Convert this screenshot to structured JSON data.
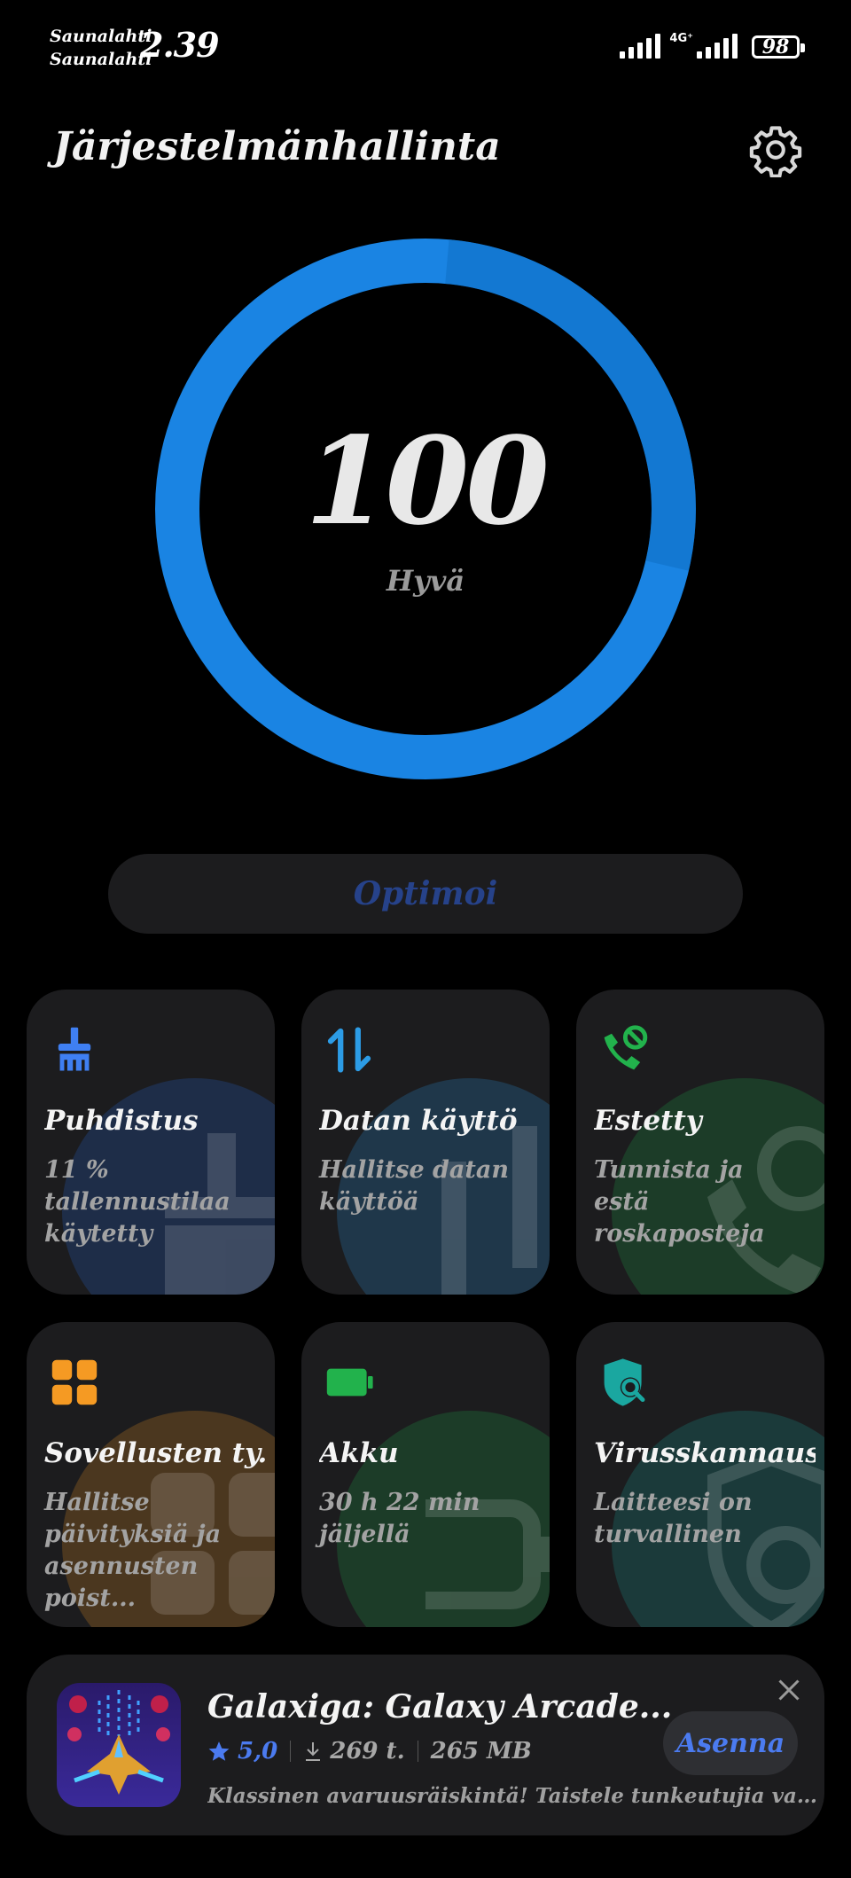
{
  "status_bar": {
    "carrier1": "Saunalahti",
    "carrier2": "Saunalahti",
    "time": "2.39",
    "network": "4G⁺",
    "battery": "98"
  },
  "header": {
    "title": "Järjestelmänhallinta",
    "settings_icon": "gear-icon"
  },
  "score": {
    "value": "100",
    "status": "Hyvä",
    "fraction": 1.0,
    "ring_color": "#1a84e3"
  },
  "optimize_label": "Optimoi",
  "tiles": [
    {
      "title": "Puhdistus",
      "subtitle": "11 % tallennustilaa käytetty",
      "icon": "broom-icon",
      "color": "#3f7ff2"
    },
    {
      "title": "Datan käyttö",
      "subtitle": "Hallitse datan käyttöä",
      "icon": "data-arrows-icon",
      "color": "#2c9ce6"
    },
    {
      "title": "Estetty",
      "subtitle": "Tunnista ja estä roskaposteja",
      "icon": "blocked-call-icon",
      "color": "#22b24c"
    },
    {
      "title": "Sovellusten ty...",
      "subtitle": "Hallitse päivityksiä ja asennusten poist...",
      "icon": "apps-grid-icon",
      "color": "#f59a23"
    },
    {
      "title": "Akku",
      "subtitle": "30 h 22 min jäljellä",
      "icon": "battery-icon",
      "color": "#22b24c"
    },
    {
      "title": "Virusskannaus",
      "subtitle": "Laitteesi on turvallinen",
      "icon": "shield-scan-icon",
      "color": "#1aa7a0"
    }
  ],
  "ad": {
    "title": "Galaxiga: Galaxy Arcade...",
    "rating": "5,0",
    "downloads": "269 t.",
    "size": "265 MB",
    "description": "Klassinen avaruusräiskintä! Taistele tunkeutujia vastaan...",
    "install_label": "Asenna",
    "accent": "#4b7bf0"
  }
}
